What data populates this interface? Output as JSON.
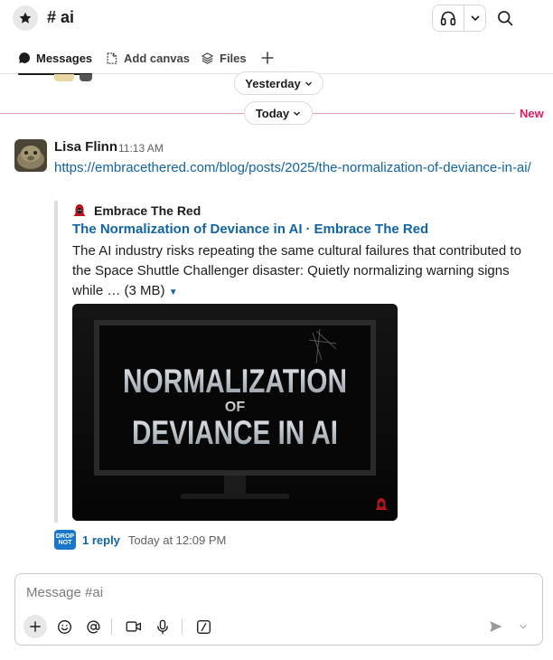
{
  "header": {
    "channel_name": "# ai",
    "star_icon": "star-icon",
    "huddle_icon": "headphones-icon",
    "search_icon": "search-icon"
  },
  "tabs": [
    {
      "label": "Messages",
      "icon": "message-bubble-icon",
      "active": true
    },
    {
      "label": "Add canvas",
      "icon": "canvas-icon",
      "active": false
    },
    {
      "label": "Files",
      "icon": "layers-icon",
      "active": false
    },
    {
      "label": "+",
      "icon": "plus-icon",
      "active": false
    }
  ],
  "dividers": {
    "yesterday": "Yesterday",
    "today": "Today",
    "new_label": "New"
  },
  "message": {
    "author": "Lisa Flinn",
    "time": "11:13 AM",
    "link": "https://embracethered.com/blog/posts/2025/the-normalization-of-deviance-in-ai/",
    "unfurl": {
      "site_name": "Embrace The Red",
      "title": "The Normalization of Deviance in AI",
      "title_site": "Embrace The Red",
      "description": "The AI industry risks repeating the same cultural failures that contributed to the Space Shuttle Challenger disaster: Quietly normalizing warning signs while …",
      "size": "(3 MB)",
      "image_text": {
        "line1": "NORMALIZATION",
        "line2": "OF",
        "line3": "DEVIANCE IN AI"
      }
    },
    "thread": {
      "reply_count": "1 reply",
      "last_reply": "Today at 12:09 PM",
      "replier_avatar_text": "DROP NOT"
    }
  },
  "composer": {
    "placeholder": "Message #ai"
  },
  "colors": {
    "link": "#1264a3",
    "new": "#e01e5a",
    "text": "#1d1c1d"
  }
}
